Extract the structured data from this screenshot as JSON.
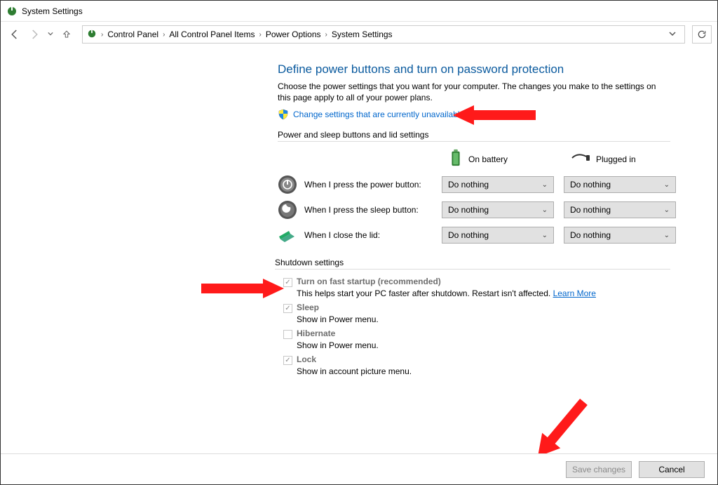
{
  "window": {
    "title": "System Settings"
  },
  "breadcrumb": {
    "items": [
      "Control Panel",
      "All Control Panel Items",
      "Power Options",
      "System Settings"
    ]
  },
  "page": {
    "heading": "Define power buttons and turn on password protection",
    "description": "Choose the power settings that you want for your computer. The changes you make to the settings on this page apply to all of your power plans.",
    "change_link": "Change settings that are currently unavailable"
  },
  "power_section": {
    "label": "Power and sleep buttons and lid settings",
    "col_battery": "On battery",
    "col_plugged": "Plugged in",
    "rows": [
      {
        "label": "When I press the power button:",
        "battery": "Do nothing",
        "plugged": "Do nothing"
      },
      {
        "label": "When I press the sleep button:",
        "battery": "Do nothing",
        "plugged": "Do nothing"
      },
      {
        "label": "When I close the lid:",
        "battery": "Do nothing",
        "plugged": "Do nothing"
      }
    ]
  },
  "shutdown_section": {
    "label": "Shutdown settings",
    "items": [
      {
        "label": "Turn on fast startup (recommended)",
        "sub": "This helps start your PC faster after shutdown. Restart isn't affected. ",
        "learn": "Learn More",
        "checked": true
      },
      {
        "label": "Sleep",
        "sub": "Show in Power menu.",
        "checked": true
      },
      {
        "label": "Hibernate",
        "sub": "Show in Power menu.",
        "checked": false
      },
      {
        "label": "Lock",
        "sub": "Show in account picture menu.",
        "checked": true
      }
    ]
  },
  "footer": {
    "save": "Save changes",
    "cancel": "Cancel"
  }
}
